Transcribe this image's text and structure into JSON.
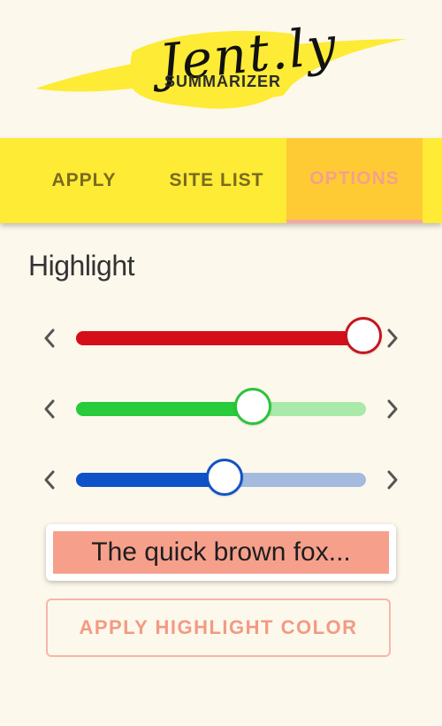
{
  "logo": {
    "script_text": "Jent.ly",
    "subtitle": "SUMMARIZER",
    "brush_color": "#fdeb36"
  },
  "tabs": [
    {
      "label": "APPLY",
      "active": false
    },
    {
      "label": "SITE LIST",
      "active": false
    },
    {
      "label": "OPTIONS",
      "active": true
    }
  ],
  "section": {
    "title": "Highlight"
  },
  "sliders": [
    {
      "channel": "red",
      "value": 1.0,
      "fill_color": "#d40f1a",
      "track_color": "#e89ba0",
      "thumb_border": "#c51620"
    },
    {
      "channel": "green",
      "value": 0.62,
      "fill_color": "#28cc3a",
      "track_color": "#a9e9a9",
      "thumb_border": "#2ac43a"
    },
    {
      "channel": "blue",
      "value": 0.52,
      "fill_color": "#0f52c8",
      "track_color": "#a4badf",
      "thumb_border": "#1353c4"
    }
  ],
  "icons": {
    "decrease": "chevron-left-icon",
    "increase": "chevron-right-icon"
  },
  "preview": {
    "text": "The quick brown fox...",
    "highlight_color": "#f6a08c"
  },
  "apply_button": {
    "label": "APPLY HIGHLIGHT COLOR"
  }
}
